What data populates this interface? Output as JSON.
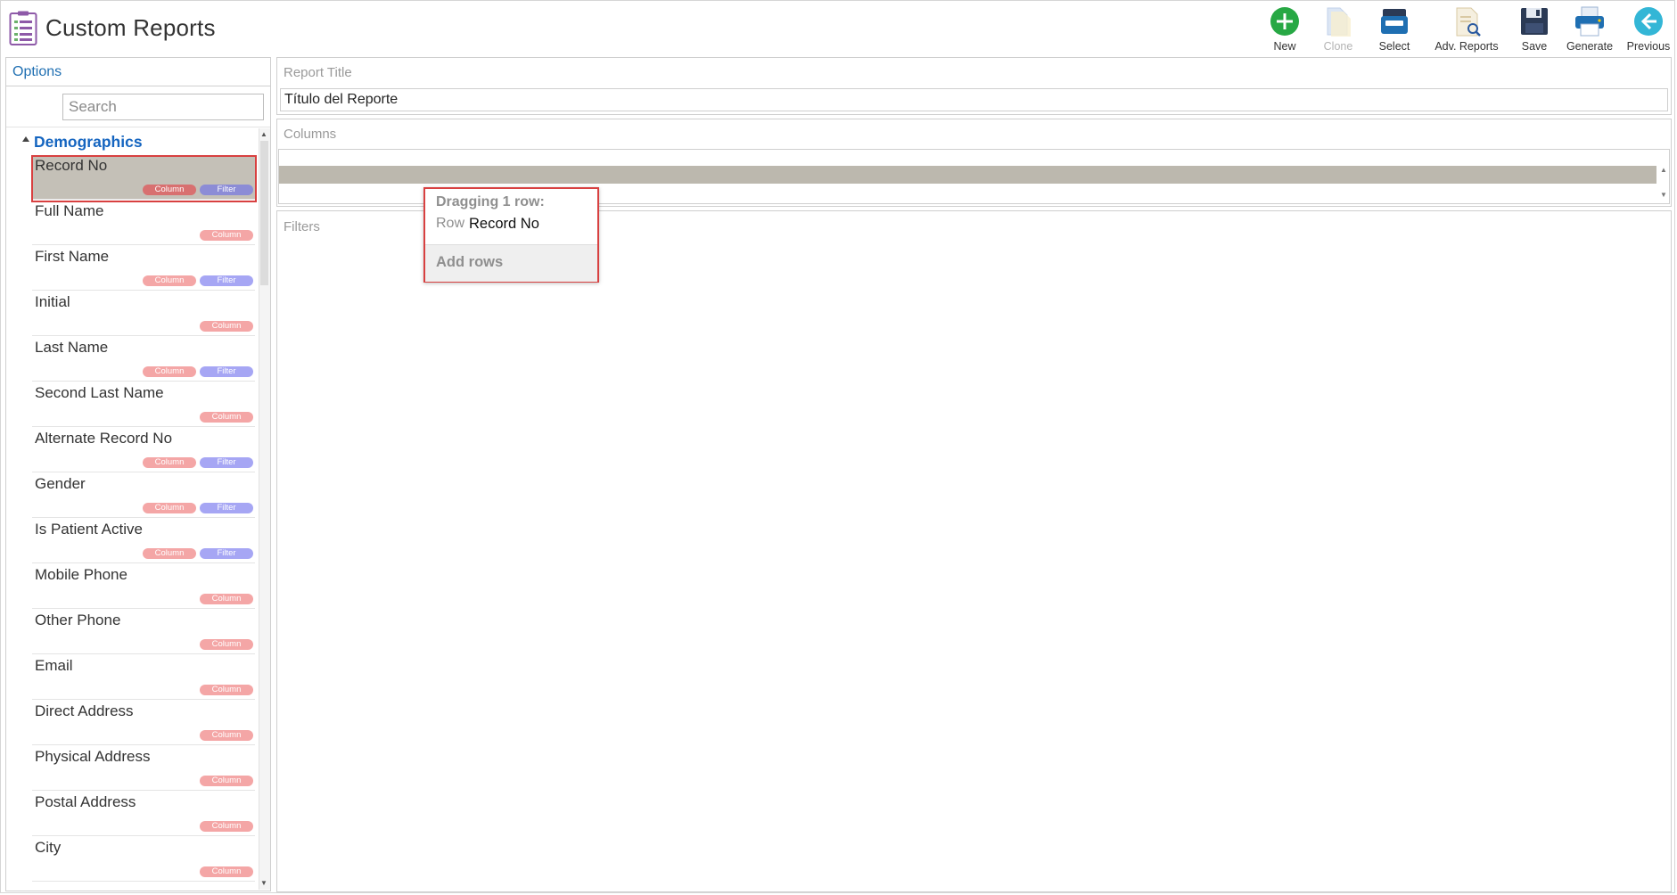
{
  "app": {
    "title": "Custom Reports",
    "icon": "report-list-icon"
  },
  "toolbar": [
    {
      "label": "New",
      "icon": "plus-circle-icon",
      "color": "#27a844",
      "enabled": true
    },
    {
      "label": "Clone",
      "icon": "clone-document-icon",
      "color": "#c9d8ee",
      "enabled": false
    },
    {
      "label": "Select",
      "icon": "inbox-tray-icon",
      "color": "#1f6fb2",
      "enabled": true
    },
    {
      "label": "Adv. Reports",
      "icon": "document-search-icon",
      "color": "#d9c9a3",
      "enabled": true
    },
    {
      "label": "Save",
      "icon": "floppy-disk-icon",
      "color": "#2b3a55",
      "enabled": true
    },
    {
      "label": "Generate",
      "icon": "printer-icon",
      "color": "#1f6fb2",
      "enabled": true
    },
    {
      "label": "Previous",
      "icon": "arrow-left-circle-icon",
      "color": "#33b6d6",
      "enabled": true
    }
  ],
  "options": {
    "title": "Options",
    "search_placeholder": "Search",
    "group": "Demographics",
    "badge_column": "Column",
    "badge_filter": "Filter",
    "items": [
      {
        "name": "Record No",
        "filter": true,
        "selected": true
      },
      {
        "name": "Full Name",
        "filter": false
      },
      {
        "name": "First Name",
        "filter": true
      },
      {
        "name": "Initial",
        "filter": false
      },
      {
        "name": "Last Name",
        "filter": true
      },
      {
        "name": "Second Last Name",
        "filter": false
      },
      {
        "name": "Alternate Record No",
        "filter": true
      },
      {
        "name": "Gender",
        "filter": true
      },
      {
        "name": "Is Patient Active",
        "filter": true
      },
      {
        "name": "Mobile Phone",
        "filter": false
      },
      {
        "name": "Other Phone",
        "filter": false
      },
      {
        "name": "Email",
        "filter": false
      },
      {
        "name": "Direct Address",
        "filter": false
      },
      {
        "name": "Physical Address",
        "filter": false
      },
      {
        "name": "Postal Address",
        "filter": false
      },
      {
        "name": "City",
        "filter": false
      }
    ]
  },
  "report": {
    "title_label": "Report Title",
    "title_value": "Título del Reporte",
    "columns_label": "Columns",
    "filters_label": "Filters"
  },
  "drag": {
    "heading": "Dragging 1 row:",
    "row_label": "Row",
    "row_value": "Record No",
    "action": "Add rows"
  },
  "colors": {
    "accent": "#1f6fb2",
    "highlight": "#d84040",
    "column_badge": "#f4a6a6",
    "filter_badge": "#a6a6f4"
  }
}
